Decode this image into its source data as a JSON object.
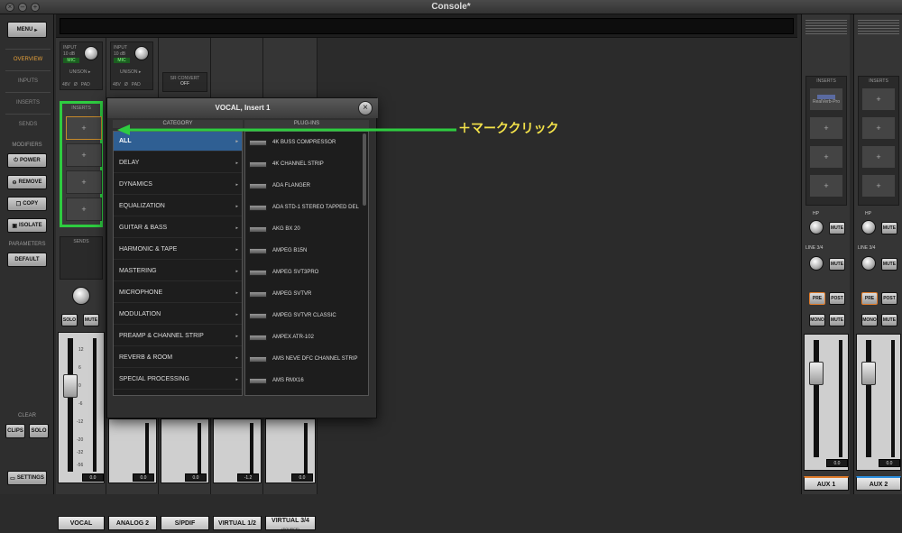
{
  "window": {
    "title": "Console*"
  },
  "sidebar": {
    "menu_label": "MENU",
    "nav": [
      {
        "label": "OVERVIEW"
      },
      {
        "label": "INPUTS"
      },
      {
        "label": "INSERTS"
      },
      {
        "label": "SENDS"
      }
    ],
    "modifiers_header": "MODIFIERS",
    "modifiers": [
      {
        "label": "POWER"
      },
      {
        "label": "REMOVE"
      },
      {
        "label": "COPY"
      },
      {
        "label": "ISOLATE"
      }
    ],
    "parameters_header": "PARAMETERS",
    "default_label": "DEFAULT",
    "clear_header": "CLEAR",
    "clips_label": "CLIPS",
    "solo_label": "SOLO",
    "settings_label": "SETTINGS"
  },
  "channels": [
    {
      "name": "VOCAL",
      "input_label": "INPUT",
      "gain": "10 dB",
      "source": "MIC",
      "unison": "UNISON ▸",
      "value": "0.0"
    },
    {
      "name": "ANALOG 2",
      "input_label": "INPUT",
      "gain": "10 dB",
      "source": "MIC",
      "unison": "UNISON ▸",
      "value": "0.0"
    },
    {
      "name": "S/PDIF",
      "value": "0.0"
    },
    {
      "name": "VIRTUAL 1/2",
      "value": "-1.2"
    },
    {
      "name": "VIRTUAL 3/4",
      "sub": "(SOURCE)",
      "value": "0.0"
    }
  ],
  "input_flags": [
    "48V",
    "Ø",
    "PAD"
  ],
  "sr_convert": {
    "label": "SR CONVERT",
    "value": "OFF"
  },
  "inserts_label": "INSERTS",
  "sends_label": "SENDS",
  "solo_label": "SOLO",
  "mute_label": "MUTE",
  "fader_scale": [
    "12",
    "6",
    "0",
    "-6",
    "-12",
    "-20",
    "-32",
    "-56"
  ],
  "meter_scale": [
    "12",
    "6",
    "0",
    "-6",
    "-12",
    "-20",
    "-32",
    "-56"
  ],
  "popup": {
    "title": "VOCAL, Insert 1",
    "category_header": "CATEGORY",
    "plugins_header": "PLUG-INS",
    "categories": [
      "ALL",
      "DELAY",
      "DYNAMICS",
      "EQUALIZATION",
      "GUITAR & BASS",
      "HARMONIC & TAPE",
      "MASTERING",
      "MICROPHONE",
      "MODULATION",
      "PREAMP & CHANNEL STRIP",
      "REVERB & ROOM",
      "SPECIAL PROCESSING"
    ],
    "plugins": [
      "4K BUSS COMPRESSOR",
      "4K CHANNEL STRIP",
      "ADA FLANGER",
      "ADA STD-1 STEREO TAPPED DEL",
      "AKG BX 20",
      "AMPEG B15N",
      "AMPEG SVT3PRO",
      "AMPEG SVTVR",
      "AMPEG SVTVR CLASSIC",
      "AMPEX ATR-102",
      "AMS NEVE DFC CHANNEL STRIP",
      "AMS RMX16"
    ]
  },
  "annotation": {
    "text": "＋マーククリック",
    "color": "#2ecc40"
  },
  "aux": [
    {
      "name": "AUX 1",
      "inserts_label": "INSERTS",
      "plugin": "RealVerb-Pro",
      "hp_label": "HP",
      "line_label": "LINE 3/4",
      "pre": "PRE",
      "post": "POST",
      "mono": "MONO",
      "mute": "MUTE",
      "value": "0.0",
      "accent": "#e07b2a"
    },
    {
      "name": "AUX 2",
      "inserts_label": "INSERTS",
      "hp_label": "HP",
      "line_label": "LINE 3/4",
      "pre": "PRE",
      "post": "POST",
      "mono": "MONO",
      "mute": "MUTE",
      "value": "0.0",
      "accent": "#2a8fe0"
    }
  ]
}
